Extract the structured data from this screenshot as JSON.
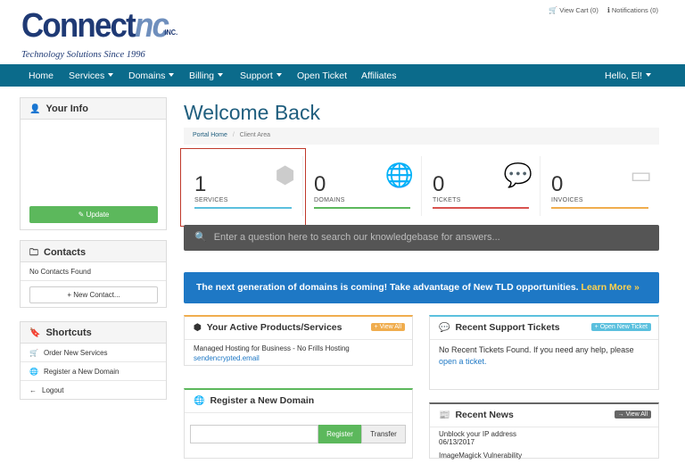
{
  "brand": {
    "name_main": "Connect",
    "name_accent": "nc",
    "name_suffix": "INC.",
    "tagline": "Technology Solutions Since 1996"
  },
  "toplinks": {
    "cart": "View Cart (0)",
    "notifications": "Notifications (0)"
  },
  "nav": {
    "items": [
      {
        "label": "Home",
        "dropdown": false
      },
      {
        "label": "Services",
        "dropdown": true
      },
      {
        "label": "Domains",
        "dropdown": true
      },
      {
        "label": "Billing",
        "dropdown": true
      },
      {
        "label": "Support",
        "dropdown": true
      },
      {
        "label": "Open Ticket",
        "dropdown": false
      },
      {
        "label": "Affiliates",
        "dropdown": false
      }
    ],
    "user": "Hello, El!"
  },
  "sidebar": {
    "your_info": {
      "title": "Your Info",
      "button": "Update"
    },
    "contacts": {
      "title": "Contacts",
      "empty": "No Contacts Found",
      "button": "New Contact..."
    },
    "shortcuts": {
      "title": "Shortcuts",
      "items": [
        {
          "label": "Order New Services",
          "icon": "cart-icon"
        },
        {
          "label": "Register a New Domain",
          "icon": "globe-icon"
        },
        {
          "label": "Logout",
          "icon": "arrow-left-icon"
        }
      ]
    }
  },
  "main": {
    "title": "Welcome Back",
    "breadcrumb": {
      "home": "Portal Home",
      "sep": "/",
      "current": "Client Area"
    },
    "stats": [
      {
        "value": "1",
        "label": "SERVICES",
        "color": "#5bc0de",
        "icon": "cube-icon"
      },
      {
        "value": "0",
        "label": "DOMAINS",
        "color": "#5cb85c",
        "icon": "globe-icon"
      },
      {
        "value": "0",
        "label": "TICKETS",
        "color": "#d9534f",
        "icon": "comments-icon"
      },
      {
        "value": "0",
        "label": "INVOICES",
        "color": "#f0ad4e",
        "icon": "credit-card-icon"
      }
    ],
    "search_placeholder": "Enter a question here to search our knowledgebase for answers...",
    "banner": {
      "text": "The next generation of domains is coming! Take advantage of New TLD opportunities.",
      "link": "Learn More »"
    },
    "products": {
      "title": "Your Active Products/Services",
      "button": "View All",
      "item_name": "Managed Hosting for Business - No Frills Hosting",
      "item_domain": "sendencrypted.email"
    },
    "register": {
      "title": "Register a New Domain",
      "register_btn": "Register",
      "transfer_btn": "Transfer"
    },
    "tickets": {
      "title": "Recent Support Tickets",
      "button": "Open New Ticket",
      "text": "No Recent Tickets Found. If you need any help, please",
      "link": "open a ticket."
    },
    "news": {
      "title": "Recent News",
      "button": "View All",
      "items": [
        {
          "title": "Unblock your IP address",
          "date": "06/13/2017"
        },
        {
          "title": "ImageMagick Vulnerability",
          "date": ""
        }
      ]
    }
  },
  "colors": {
    "navbar": "#0b6b8b",
    "accent_blue": "#1f5e7e",
    "green": "#5cb85c",
    "banner": "#1e78c5"
  }
}
